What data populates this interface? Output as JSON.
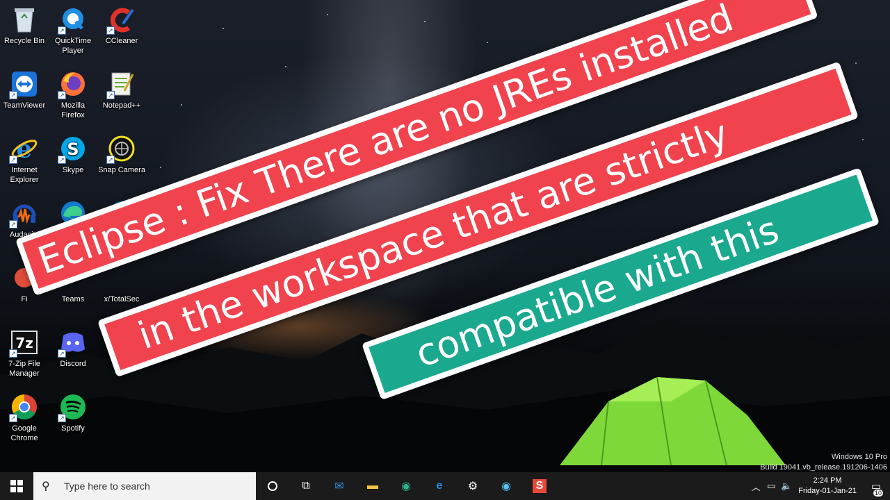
{
  "banner": {
    "line1": "Eclipse : Fix There are no JREs installed",
    "line2": "in the workspace that are strictly",
    "line3": "compatible with this"
  },
  "desktop_icons": [
    {
      "label": "Recycle Bin",
      "icon": "recycle-bin-icon"
    },
    {
      "label": "QuickTime Player",
      "icon": "quicktime-icon"
    },
    {
      "label": "CCleaner",
      "icon": "ccleaner-icon"
    },
    {
      "label": "TeamViewer",
      "icon": "teamviewer-icon"
    },
    {
      "label": "Mozilla Firefox",
      "icon": "firefox-icon"
    },
    {
      "label": "Notepad++",
      "icon": "notepadpp-icon"
    },
    {
      "label": "Internet Explorer",
      "icon": "internet-explorer-icon"
    },
    {
      "label": "Skype",
      "icon": "skype-icon"
    },
    {
      "label": "Snap Camera",
      "icon": "snap-camera-icon"
    },
    {
      "label": "Audacity",
      "icon": "audacity-icon"
    },
    {
      "label": "Fi",
      "icon": "partial-icon"
    },
    {
      "label": "Teams",
      "icon": "teams-icon"
    },
    {
      "label": "x/TotalSec",
      "icon": "totalsec-icon"
    },
    {
      "label": "7-Zip File Manager",
      "icon": "seven-zip-icon"
    },
    {
      "label": "Discord",
      "icon": "discord-icon"
    },
    {
      "label": "Google Chrome",
      "icon": "chrome-icon"
    },
    {
      "label": "Spotify",
      "icon": "spotify-icon"
    }
  ],
  "watermark": {
    "line1": "Windows 10 Pro",
    "line2": "Build 19041.vb_release.191206-1406"
  },
  "taskbar": {
    "search_placeholder": "Type here to search",
    "clock_time": "2:24 PM",
    "clock_date": "Friday-01-Jan-21",
    "notification_count": "10"
  }
}
